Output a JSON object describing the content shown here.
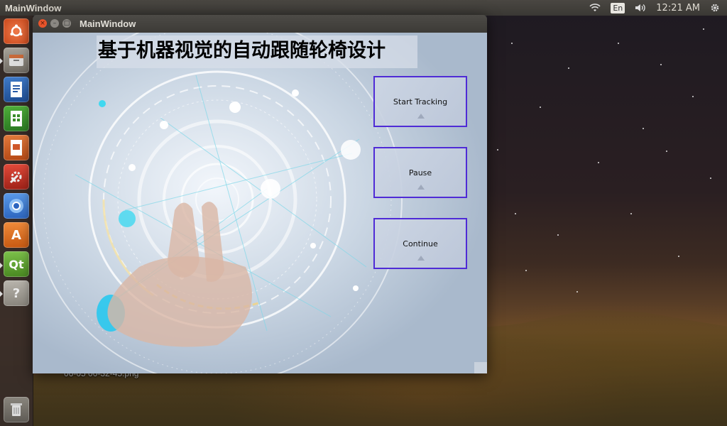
{
  "topbar": {
    "app_title": "MainWindow",
    "language": "En",
    "time": "12:21 AM"
  },
  "launcher": {
    "items": [
      {
        "name": "ubuntu-dash",
        "label": "Ubuntu Dash"
      },
      {
        "name": "files",
        "label": "Files"
      },
      {
        "name": "libreoffice-writer",
        "label": "LibreOffice Writer"
      },
      {
        "name": "libreoffice-calc",
        "label": "LibreOffice Calc"
      },
      {
        "name": "libreoffice-impress",
        "label": "LibreOffice Impress"
      },
      {
        "name": "system-settings",
        "label": "System Settings"
      },
      {
        "name": "chromium",
        "label": "Chromium"
      },
      {
        "name": "software-center",
        "label": "Ubuntu Software"
      },
      {
        "name": "qt-creator",
        "label": "Qt Creator"
      },
      {
        "name": "unknown-app",
        "label": "?"
      },
      {
        "name": "trash",
        "label": "Trash"
      }
    ]
  },
  "desktop": {
    "file_label": "06-05 00-32-45.png"
  },
  "window": {
    "title": "MainWindow",
    "headline": "基于机器视觉的自动跟随轮椅设计",
    "buttons": {
      "start": "Start Tracking",
      "pause": "Pause",
      "continue": "Continue"
    }
  },
  "colors": {
    "button_border": "#4f2bd6",
    "accent_orange": "#e95420"
  }
}
